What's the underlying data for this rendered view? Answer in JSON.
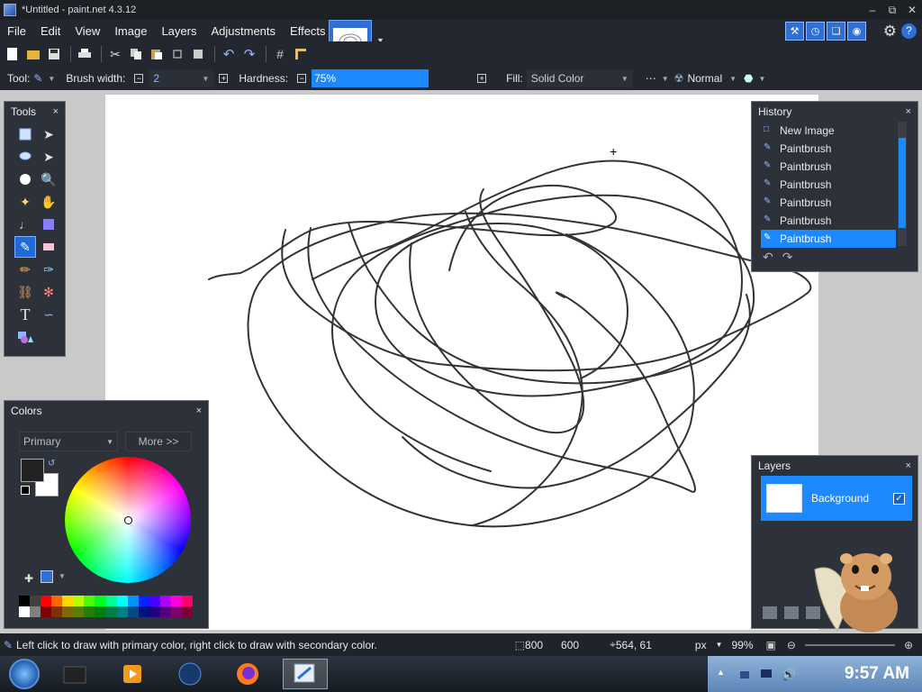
{
  "window": {
    "title": "*Untitled - paint.net 4.3.12"
  },
  "menu": {
    "items": [
      "File",
      "Edit",
      "View",
      "Image",
      "Layers",
      "Adjustments",
      "Effects"
    ]
  },
  "options": {
    "tool_label": "Tool:",
    "brush_width_label": "Brush width:",
    "brush_width_value": "2",
    "hardness_label": "Hardness:",
    "hardness_value": "75%",
    "fill_label": "Fill:",
    "fill_value": "Solid Color",
    "blend_mode": "Normal"
  },
  "tools_panel": {
    "title": "Tools",
    "close": "×",
    "text_tool_glyph": "T"
  },
  "colors_panel": {
    "title": "Colors",
    "close": "×",
    "mode": "Primary",
    "more_button": "More >>",
    "primary_color": "#222222",
    "secondary_color": "#ffffff"
  },
  "history_panel": {
    "title": "History",
    "close": "×",
    "items": [
      "New Image",
      "Paintbrush",
      "Paintbrush",
      "Paintbrush",
      "Paintbrush",
      "Paintbrush",
      "Paintbrush"
    ],
    "active_index": 6
  },
  "layers_panel": {
    "title": "Layers",
    "close": "×",
    "layer_name": "Background",
    "visible": true
  },
  "status": {
    "hint": "Left click to draw with primary color, right click to draw with secondary color.",
    "image_width": "800",
    "image_height": "600",
    "cursor_pos": "564, 61",
    "units": "px",
    "zoom": "99%"
  },
  "taskbar": {
    "clock": "9:57 AM"
  },
  "colors": {
    "accent": "#1e88ff",
    "panel_bg": "#2d323a",
    "toolbar_bg": "#232830"
  }
}
